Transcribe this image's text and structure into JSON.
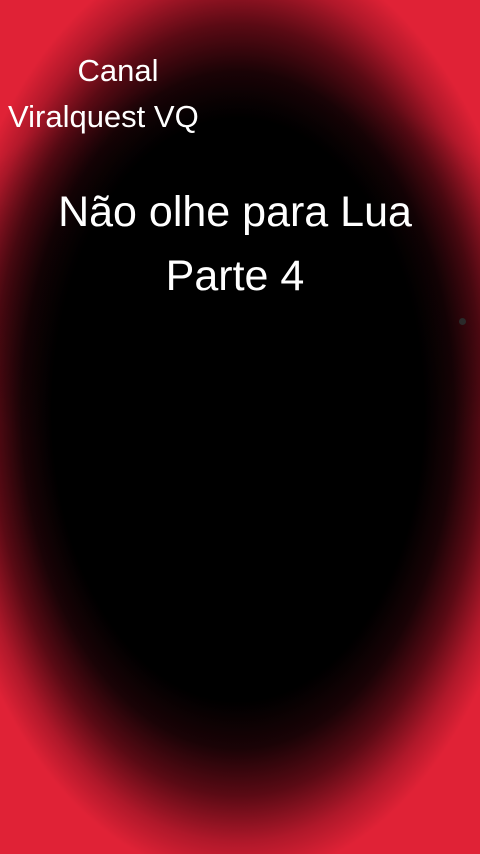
{
  "channel": {
    "line1": "Canal",
    "line2": "Viralquest VQ"
  },
  "title": {
    "line1": "Não olhe para Lua",
    "line2": "Parte 4"
  },
  "colors": {
    "background_center": "#000000",
    "vignette_edge": "#e02236",
    "text": "#ffffff"
  }
}
